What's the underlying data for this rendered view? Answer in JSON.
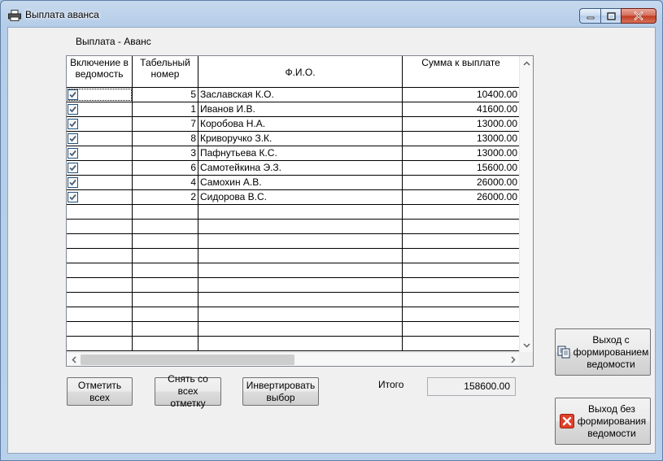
{
  "window": {
    "title": "Выплата аванса",
    "app_icon": "printer-icon",
    "caption_buttons": [
      "minimize-icon",
      "maximize-icon",
      "close-icon"
    ]
  },
  "form": {
    "subtitle": "Выплата - Аванс",
    "total_label": "Итого",
    "total_value": "158600.00"
  },
  "table": {
    "columns": [
      "Включение в ведомость",
      "Табельный номер",
      "Ф.И.О.",
      "Сумма к выплате"
    ],
    "rows": [
      {
        "checked": true,
        "tab": "5",
        "name": "Заславская К.О.",
        "sum": "10400.00"
      },
      {
        "checked": true,
        "tab": "1",
        "name": "Иванов И.В.",
        "sum": "41600.00"
      },
      {
        "checked": true,
        "tab": "7",
        "name": "Коробова Н.А.",
        "sum": "13000.00"
      },
      {
        "checked": true,
        "tab": "8",
        "name": "Криворучко З.К.",
        "sum": "13000.00"
      },
      {
        "checked": true,
        "tab": "3",
        "name": "Пафнутьева К.С.",
        "sum": "13000.00"
      },
      {
        "checked": true,
        "tab": "6",
        "name": "Самотейкина Э.З.",
        "sum": "15600.00"
      },
      {
        "checked": true,
        "tab": "4",
        "name": "Самохин А.В.",
        "sum": "26000.00"
      },
      {
        "checked": true,
        "tab": "2",
        "name": "Сидорова В.С.",
        "sum": "26000.00"
      }
    ]
  },
  "buttons": {
    "mark_all": "Отметить\nвсех",
    "unmark_all": "Снять со всех\nотметку",
    "invert": "Инвертировать\nвыбор",
    "exit_with": "Выход с\nформированием\nведомости",
    "exit_without": "Выход без\nформирования\nведомости"
  },
  "colors": {
    "checkmark": "#4a5f76",
    "close_red": "#e0402a"
  }
}
